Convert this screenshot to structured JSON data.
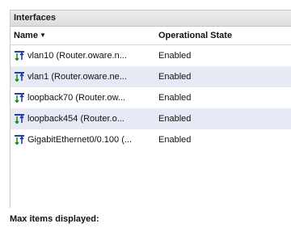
{
  "panel": {
    "title": "Interfaces"
  },
  "table": {
    "columns": {
      "name": "Name",
      "state": "Operational State"
    },
    "sort_indicator": "▼",
    "rows": [
      {
        "name": "vlan10 (Router.oware.n...",
        "state": "Enabled"
      },
      {
        "name": "vlan1 (Router.oware.ne...",
        "state": "Enabled"
      },
      {
        "name": "loopback70 (Router.ow...",
        "state": "Enabled"
      },
      {
        "name": "loopback454 (Router.o...",
        "state": "Enabled"
      },
      {
        "name": "GigabitEthernet0/0.100 (...",
        "state": "Enabled"
      }
    ]
  },
  "footer": {
    "label": "Max items displayed:"
  },
  "icons": {
    "row_icon": "network-interface-icon"
  },
  "colors": {
    "alt_row": "#e7e9f5",
    "icon_green": "#1f8a2a",
    "icon_blue": "#1f3fa8"
  }
}
